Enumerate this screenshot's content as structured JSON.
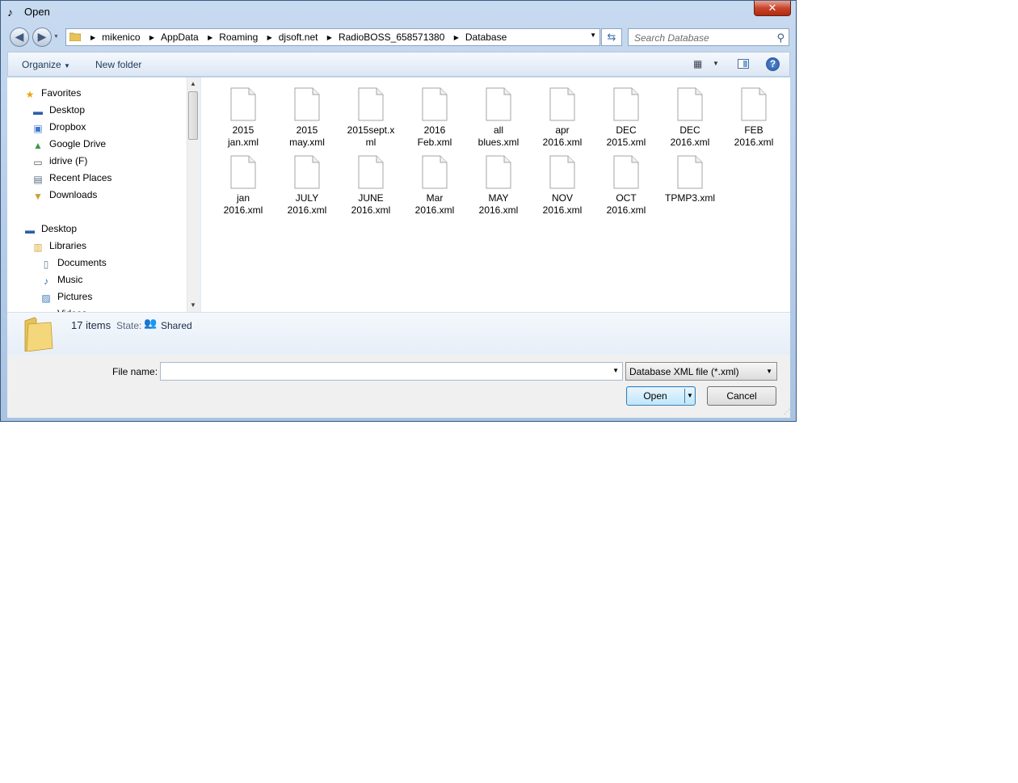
{
  "window": {
    "title": "Open",
    "close_label": "✕"
  },
  "address": {
    "crumbs": [
      "mikenico",
      "AppData",
      "Roaming",
      "djsoft.net",
      "RadioBOSS_658571380",
      "Database"
    ]
  },
  "search": {
    "placeholder": "Search Database"
  },
  "toolbar": {
    "organize_label": "Organize",
    "new_folder_label": "New folder",
    "help_label": "?"
  },
  "nav": {
    "items": [
      {
        "label": "Favorites",
        "icon": "star-icon"
      },
      {
        "label": "Desktop",
        "icon": "desktop-icon"
      },
      {
        "label": "Dropbox",
        "icon": "dropbox-icon"
      },
      {
        "label": "Google Drive",
        "icon": "google-drive-icon"
      },
      {
        "label": "idrive (F)",
        "icon": "drive-icon"
      },
      {
        "label": "Recent Places",
        "icon": "recent-places-icon"
      },
      {
        "label": "Downloads",
        "icon": "downloads-icon"
      },
      {
        "label": "Desktop",
        "icon": "desktop-icon"
      },
      {
        "label": "Libraries",
        "icon": "libraries-icon"
      },
      {
        "label": "Documents",
        "icon": "documents-icon"
      },
      {
        "label": "Music",
        "icon": "music-icon"
      },
      {
        "label": "Pictures",
        "icon": "pictures-icon"
      },
      {
        "label": "Videos",
        "icon": "videos-icon"
      }
    ]
  },
  "files": [
    {
      "line1": "2015",
      "line2": "jan.xml"
    },
    {
      "line1": "2015",
      "line2": "may.xml"
    },
    {
      "line1": "2015sept.x",
      "line2": "ml"
    },
    {
      "line1": "2016",
      "line2": "Feb.xml"
    },
    {
      "line1": "all",
      "line2": "blues.xml"
    },
    {
      "line1": "apr",
      "line2": "2016.xml"
    },
    {
      "line1": "DEC",
      "line2": "2015.xml"
    },
    {
      "line1": "DEC",
      "line2": "2016.xml"
    },
    {
      "line1": "FEB",
      "line2": "2016.xml"
    },
    {
      "line1": "jan",
      "line2": "2016.xml"
    },
    {
      "line1": "JULY",
      "line2": "2016.xml"
    },
    {
      "line1": "JUNE",
      "line2": "2016.xml"
    },
    {
      "line1": "Mar",
      "line2": "2016.xml"
    },
    {
      "line1": "MAY",
      "line2": "2016.xml"
    },
    {
      "line1": "NOV",
      "line2": "2016.xml"
    },
    {
      "line1": "OCT",
      "line2": "2016.xml"
    },
    {
      "line1": "TPMP3.xml",
      "line2": ""
    }
  ],
  "details": {
    "count": "17 items",
    "state_label": "State:",
    "state_value": "Shared"
  },
  "bottom": {
    "filename_label": "File name:",
    "filename_value": "",
    "filetype": "Database XML file (*.xml)",
    "open_label": "Open",
    "cancel_label": "Cancel"
  }
}
